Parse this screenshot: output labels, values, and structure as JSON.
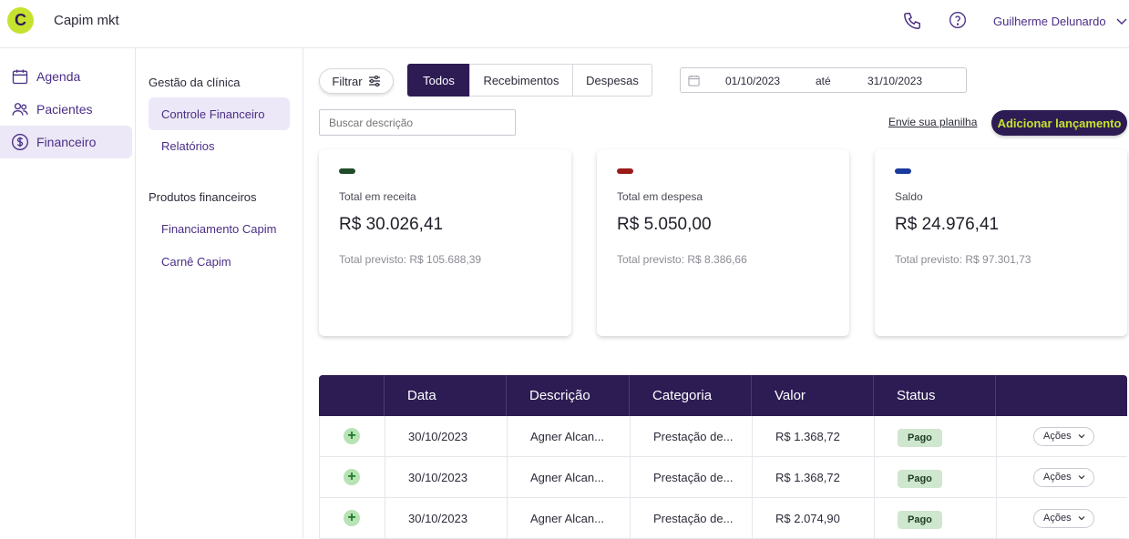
{
  "header": {
    "logo_letter": "C",
    "app_name": "Capim mkt",
    "user_name": "Guilherme Delunardo"
  },
  "sidebar": {
    "items": [
      {
        "label": "Agenda",
        "icon": "calendar-icon"
      },
      {
        "label": "Pacientes",
        "icon": "users-icon"
      },
      {
        "label": "Financeiro",
        "icon": "dollar-circle-icon",
        "active": true
      }
    ]
  },
  "subnav": {
    "group1": "Gestão da clínica",
    "items1": [
      "Controle Financeiro",
      "Relatórios"
    ],
    "group2": "Produtos financeiros",
    "items2": [
      "Financiamento Capim",
      "Carnê Capim"
    ]
  },
  "toolbar": {
    "filter_label": "Filtrar",
    "tabs": [
      "Todos",
      "Recebimentos",
      "Despesas"
    ],
    "date_from": "01/10/2023",
    "date_sep": "até",
    "date_to": "31/10/2023",
    "search_placeholder": "Buscar descrição",
    "upload_link": "Envie sua planilha",
    "add_button": "Adicionar lançamento"
  },
  "cards": [
    {
      "label": "Total em receita",
      "value": "R$ 30.026,41",
      "forecast": "Total previsto: R$ 105.688,39",
      "color": "#1f4d2a"
    },
    {
      "label": "Total em despesa",
      "value": "R$ 5.050,00",
      "forecast": "Total previsto: R$ 8.386,66",
      "color": "#9b1b1b"
    },
    {
      "label": "Saldo",
      "value": "R$ 24.976,41",
      "forecast": "Total previsto: R$ 97.301,73",
      "color": "#1a3a9c"
    }
  ],
  "table": {
    "headers": [
      "",
      "Data",
      "Descrição",
      "Categoria",
      "Valor",
      "Status",
      ""
    ],
    "rows": [
      {
        "date": "30/10/2023",
        "desc": "Agner Alcan...",
        "category": "Prestação de...",
        "value": "R$ 1.368,72",
        "status": "Pago",
        "actions": "Ações"
      },
      {
        "date": "30/10/2023",
        "desc": "Agner Alcan...",
        "category": "Prestação de...",
        "value": "R$ 1.368,72",
        "status": "Pago",
        "actions": "Ações"
      },
      {
        "date": "30/10/2023",
        "desc": "Agner Alcan...",
        "category": "Prestação de...",
        "value": "R$ 2.074,90",
        "status": "Pago",
        "actions": "Ações"
      }
    ]
  }
}
